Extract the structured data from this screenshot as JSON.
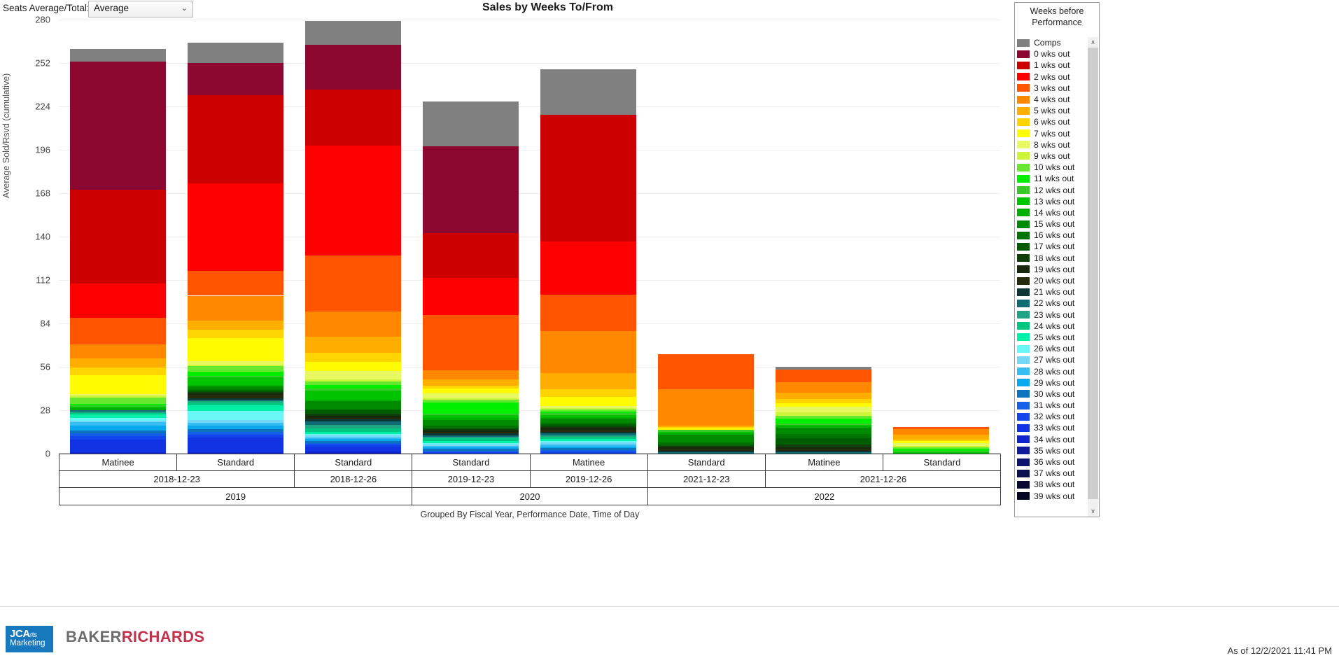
{
  "toolbar": {
    "seats_label": "Seats Average/Total:",
    "seats_value": "Average",
    "chevron": "⌄"
  },
  "header": {
    "title": "Sales by Weeks To/From"
  },
  "axes": {
    "ylabel": "Average Sold/Rsvd (cumulative)",
    "xlabel": "Grouped By Fiscal Year, Performance Date, Time of Day",
    "yticks": [
      280,
      252,
      224,
      196,
      168,
      140,
      112,
      84,
      56,
      28,
      0
    ]
  },
  "legend": {
    "title_line1": "Weeks before",
    "title_line2": "Performance",
    "scroll_up": "∧",
    "scroll_down": "∨",
    "items": [
      {
        "label": "Comps",
        "color": "#808080"
      },
      {
        "label": "0 wks out",
        "color": "#8c0830"
      },
      {
        "label": "1 wks out",
        "color": "#cc0000"
      },
      {
        "label": "2 wks out",
        "color": "#ff0000"
      },
      {
        "label": "3 wks out",
        "color": "#ff5500"
      },
      {
        "label": "4 wks out",
        "color": "#ff8800"
      },
      {
        "label": "5 wks out",
        "color": "#ffae00"
      },
      {
        "label": "6 wks out",
        "color": "#ffd400"
      },
      {
        "label": "7 wks out",
        "color": "#fffb00"
      },
      {
        "label": "8 wks out",
        "color": "#e8f860"
      },
      {
        "label": "9 wks out",
        "color": "#ccf53a"
      },
      {
        "label": "10 wks out",
        "color": "#66e82e"
      },
      {
        "label": "11 wks out",
        "color": "#00ef00"
      },
      {
        "label": "12 wks out",
        "color": "#38c828"
      },
      {
        "label": "13 wks out",
        "color": "#00c400"
      },
      {
        "label": "14 wks out",
        "color": "#00b000"
      },
      {
        "label": "15 wks out",
        "color": "#008a00"
      },
      {
        "label": "16 wks out",
        "color": "#007400"
      },
      {
        "label": "17 wks out",
        "color": "#005c00"
      },
      {
        "label": "18 wks out",
        "color": "#0f3f0a"
      },
      {
        "label": "19 wks out",
        "color": "#17280c"
      },
      {
        "label": "20 wks out",
        "color": "#262b0c"
      },
      {
        "label": "21 wks out",
        "color": "#0d3636"
      },
      {
        "label": "22 wks out",
        "color": "#0e6c74"
      },
      {
        "label": "23 wks out",
        "color": "#1fa583"
      },
      {
        "label": "24 wks out",
        "color": "#00c77f"
      },
      {
        "label": "25 wks out",
        "color": "#00f0a8"
      },
      {
        "label": "26 wks out",
        "color": "#6bf6f6"
      },
      {
        "label": "27 wks out",
        "color": "#74d7f5"
      },
      {
        "label": "28 wks out",
        "color": "#36bdf4"
      },
      {
        "label": "29 wks out",
        "color": "#0aa8ef"
      },
      {
        "label": "30 wks out",
        "color": "#0b74bd"
      },
      {
        "label": "31 wks out",
        "color": "#1560e8"
      },
      {
        "label": "32 wks out",
        "color": "#1246ec"
      },
      {
        "label": "33 wks out",
        "color": "#1233e4"
      },
      {
        "label": "34 wks out",
        "color": "#0f23cf"
      },
      {
        "label": "35 wks out",
        "color": "#101a9e"
      },
      {
        "label": "36 wks out",
        "color": "#0d1470"
      },
      {
        "label": "37 wks out",
        "color": "#0a0f4e"
      },
      {
        "label": "38 wks out",
        "color": "#070a33"
      },
      {
        "label": "39 wks out",
        "color": "#05061f"
      }
    ]
  },
  "footer": {
    "logo_jca_line1": "JCA",
    "logo_jca_line1_small": "rts",
    "logo_jca_line2": "Marketing",
    "logo_br_left": "BAKER",
    "logo_br_right": "RICHARDS",
    "as_of": "As of 12/2/2021 11:41 PM"
  },
  "category_table": {
    "row_time_of_day": [
      {
        "label": "Matinee",
        "span": 1
      },
      {
        "label": "Standard",
        "span": 1
      },
      {
        "label": "Standard",
        "span": 1
      },
      {
        "label": "Standard",
        "span": 1
      },
      {
        "label": "Matinee",
        "span": 1
      },
      {
        "label": "Standard",
        "span": 1
      },
      {
        "label": "Matinee",
        "span": 1
      },
      {
        "label": "Standard",
        "span": 1
      }
    ],
    "row_performance_date": [
      {
        "label": "2018-12-23",
        "span": 2
      },
      {
        "label": "2018-12-26",
        "span": 1
      },
      {
        "label": "2019-12-23",
        "span": 1
      },
      {
        "label": "2019-12-26",
        "span": 1
      },
      {
        "label": "2021-12-23",
        "span": 1
      },
      {
        "label": "2021-12-26",
        "span": 2
      }
    ],
    "row_fiscal_year": [
      {
        "label": "2019",
        "span": 3
      },
      {
        "label": "2020",
        "span": 2
      },
      {
        "label": "2022",
        "span": 3
      }
    ]
  },
  "chart_data": {
    "type": "bar",
    "stacked": true,
    "title": "Sales by Weeks To/From",
    "xlabel": "Grouped By Fiscal Year, Performance Date, Time of Day",
    "ylabel": "Average Sold/Rsvd (cumulative)",
    "ylim": [
      0,
      280
    ],
    "ytick_step": 28,
    "grid": true,
    "legend_position": "right",
    "categories": [
      "2019 / 2018-12-23 / Matinee",
      "2019 / 2018-12-23 / Standard",
      "2019 / 2018-12-26 / Standard",
      "2020 / 2019-12-23 / Standard",
      "2020 / 2019-12-26 / Matinee",
      "2022 / 2021-12-23 / Standard",
      "2022 / 2021-12-26 / Matinee",
      "2022 / 2021-12-26 / Standard"
    ],
    "totals": [
      261,
      265,
      279,
      227,
      248,
      64,
      56,
      17
    ],
    "series": [
      {
        "name": "Comps",
        "color": "#808080",
        "values": [
          8,
          14,
          13,
          29,
          25,
          0,
          2,
          0
        ]
      },
      {
        "name": "0 wks out",
        "color": "#8c0830",
        "values": [
          82,
          22,
          25,
          56,
          0,
          0,
          0,
          0
        ]
      },
      {
        "name": "1 wks out",
        "color": "#cc0000",
        "values": [
          60,
          60,
          31,
          29,
          69,
          0,
          0,
          0
        ]
      },
      {
        "name": "2 wks out",
        "color": "#ff0000",
        "values": [
          22,
          60,
          61,
          24,
          29,
          0,
          0,
          0
        ]
      },
      {
        "name": "3 wks out",
        "color": "#ff5500",
        "values": [
          17,
          17,
          31,
          36,
          20,
          22,
          8,
          1
        ]
      },
      {
        "name": "4 wks out",
        "color": "#ff8800",
        "values": [
          9,
          17,
          14,
          6,
          23,
          23,
          7,
          4
        ]
      },
      {
        "name": "5 wks out",
        "color": "#ffae00",
        "values": [
          6,
          6,
          9,
          4,
          9,
          1,
          4,
          3
        ]
      },
      {
        "name": "6 wks out",
        "color": "#ffd400",
        "values": [
          5,
          6,
          5,
          2,
          4,
          1,
          3,
          1
        ]
      },
      {
        "name": "7 wks out",
        "color": "#fffb00",
        "values": [
          12,
          16,
          5,
          3,
          5,
          1,
          2,
          1
        ]
      },
      {
        "name": "8 wks out",
        "color": "#e8f860",
        "values": [
          1,
          2,
          5,
          3,
          1,
          0,
          4,
          2
        ]
      },
      {
        "name": "9 wks out",
        "color": "#ccf53a",
        "values": [
          1,
          1,
          1,
          1,
          1,
          0,
          2,
          1
        ]
      },
      {
        "name": "10 wks out",
        "color": "#66e82e",
        "values": [
          4,
          4,
          2,
          2,
          1,
          0,
          2,
          1
        ]
      },
      {
        "name": "11 wks out",
        "color": "#00ef00",
        "values": [
          1,
          3,
          2,
          7,
          1,
          0,
          3,
          1
        ]
      },
      {
        "name": "12 wks out",
        "color": "#38c828",
        "values": [
          1,
          1,
          1,
          1,
          1,
          1,
          1,
          1
        ]
      },
      {
        "name": "13 wks out",
        "color": "#00c400",
        "values": [
          1,
          5,
          5,
          2,
          1,
          1,
          1,
          1
        ]
      },
      {
        "name": "14 wks out",
        "color": "#00b000",
        "values": [
          1,
          1,
          1,
          1,
          1,
          1,
          1,
          0
        ]
      },
      {
        "name": "15 wks out",
        "color": "#008a00",
        "values": [
          0,
          2,
          4,
          4,
          2,
          5,
          4,
          0
        ]
      },
      {
        "name": "16 wks out",
        "color": "#007400",
        "values": [
          0,
          1,
          1,
          1,
          1,
          1,
          3,
          0
        ]
      },
      {
        "name": "17 wks out",
        "color": "#005c00",
        "values": [
          0,
          1,
          2,
          1,
          1,
          1,
          4,
          0
        ]
      },
      {
        "name": "18 wks out",
        "color": "#0f3f0a",
        "values": [
          0,
          1,
          1,
          1,
          1,
          1,
          2,
          0
        ]
      },
      {
        "name": "19 wks out",
        "color": "#17280c",
        "values": [
          0,
          1,
          1,
          1,
          1,
          1,
          1,
          0
        ]
      },
      {
        "name": "20 wks out",
        "color": "#262b0c",
        "values": [
          0,
          2,
          1,
          1,
          1,
          1,
          1,
          0
        ]
      },
      {
        "name": "21 wks out",
        "color": "#0d3636",
        "values": [
          0,
          1,
          1,
          1,
          1,
          1,
          1,
          0
        ]
      },
      {
        "name": "22 wks out",
        "color": "#0e6c74",
        "values": [
          1,
          1,
          2,
          1,
          1,
          1,
          1,
          0
        ]
      },
      {
        "name": "23 wks out",
        "color": "#1fa583",
        "values": [
          1,
          1,
          2,
          1,
          1,
          0,
          0,
          0
        ]
      },
      {
        "name": "24 wks out",
        "color": "#00c77f",
        "values": [
          1,
          2,
          2,
          2,
          1,
          0,
          0,
          0
        ]
      },
      {
        "name": "25 wks out",
        "color": "#00f0a8",
        "values": [
          2,
          4,
          1,
          1,
          1,
          0,
          0,
          0
        ]
      },
      {
        "name": "26 wks out",
        "color": "#6bf6f6",
        "values": [
          2,
          6,
          1,
          1,
          1,
          0,
          0,
          0
        ]
      },
      {
        "name": "27 wks out",
        "color": "#74d7f5",
        "values": [
          1,
          2,
          1,
          1,
          1,
          0,
          0,
          0
        ]
      },
      {
        "name": "28 wks out",
        "color": "#36bdf4",
        "values": [
          2,
          2,
          1,
          1,
          1,
          0,
          0,
          0
        ]
      },
      {
        "name": "29 wks out",
        "color": "#0aa8ef",
        "values": [
          3,
          2,
          1,
          1,
          1,
          0,
          0,
          0
        ]
      },
      {
        "name": "30 wks out",
        "color": "#0b74bd",
        "values": [
          2,
          2,
          1,
          1,
          1,
          0,
          0,
          0
        ]
      },
      {
        "name": "31 wks out",
        "color": "#1560e8",
        "values": [
          2,
          2,
          1,
          1,
          1,
          0,
          0,
          0
        ]
      },
      {
        "name": "32 wks out",
        "color": "#1246ec",
        "values": [
          2,
          2,
          1,
          1,
          1,
          0,
          0,
          0
        ]
      },
      {
        "name": "33 wks out",
        "color": "#1233e4",
        "values": [
          8,
          10,
          3,
          0,
          0,
          0,
          0,
          0
        ]
      },
      {
        "name": "34 wks out",
        "color": "#0f23cf",
        "values": [
          1,
          1,
          1,
          0,
          0,
          0,
          0,
          0
        ]
      },
      {
        "name": "35 wks out",
        "color": "#101a9e",
        "values": [
          0,
          0,
          0,
          0,
          0,
          0,
          0,
          0
        ]
      },
      {
        "name": "36 wks out",
        "color": "#0d1470",
        "values": [
          0,
          0,
          0,
          0,
          0,
          0,
          0,
          0
        ]
      },
      {
        "name": "37 wks out",
        "color": "#0a0f4e",
        "values": [
          0,
          0,
          0,
          0,
          0,
          0,
          0,
          0
        ]
      },
      {
        "name": "38 wks out",
        "color": "#070a33",
        "values": [
          0,
          0,
          0,
          0,
          0,
          0,
          0,
          0
        ]
      },
      {
        "name": "39 wks out",
        "color": "#05061f",
        "values": [
          0,
          0,
          0,
          0,
          0,
          0,
          0,
          0
        ]
      }
    ]
  }
}
